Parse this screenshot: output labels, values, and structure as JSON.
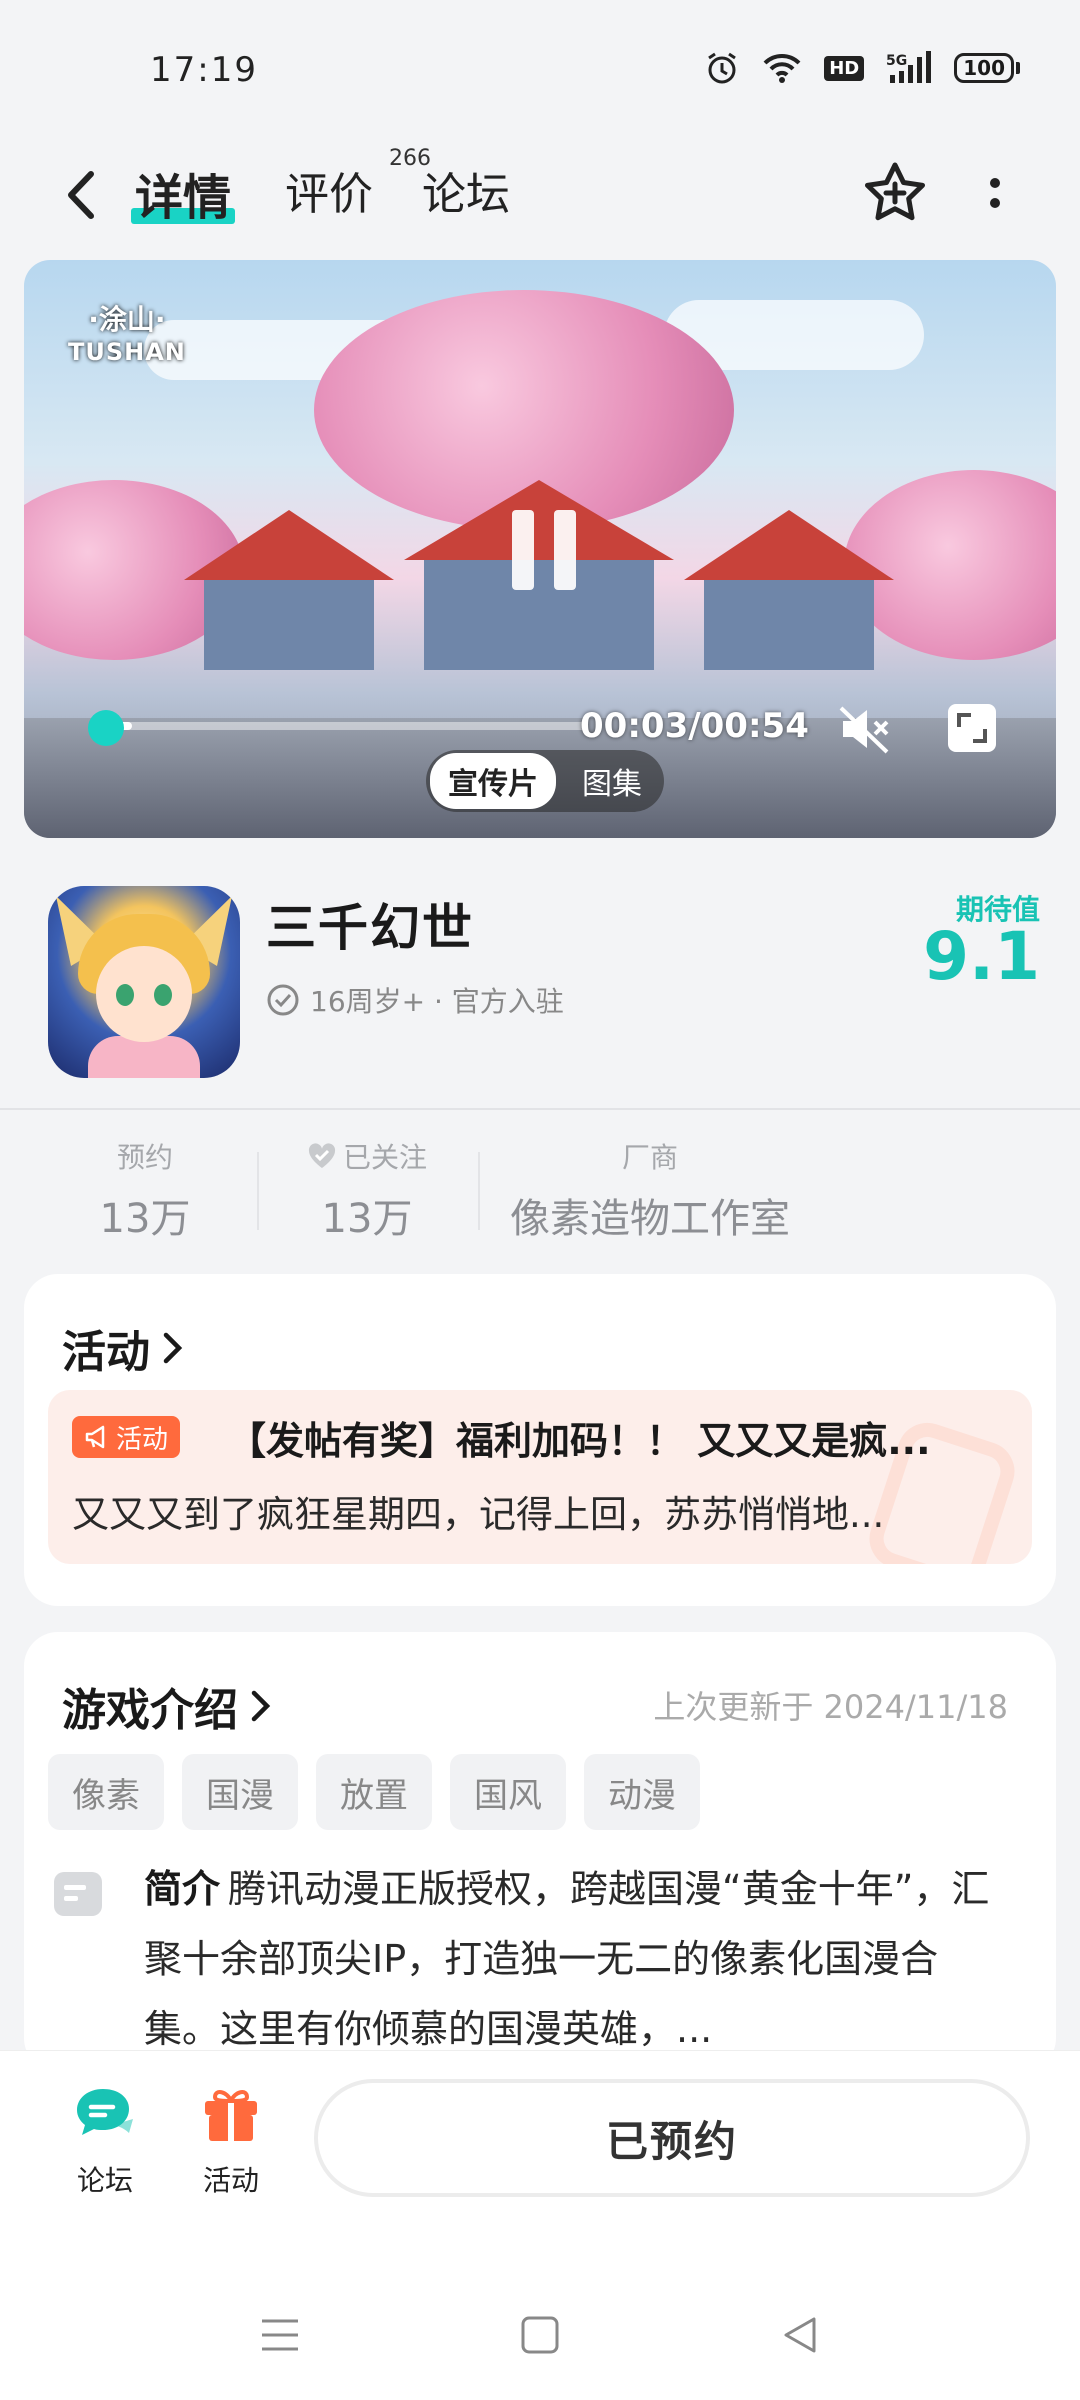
{
  "status_bar": {
    "time": "17:19",
    "network": "5G",
    "hd": "HD",
    "battery": "100"
  },
  "header": {
    "tabs": [
      {
        "label": "详情",
        "active": true
      },
      {
        "label": "评价",
        "badge": "266"
      },
      {
        "label": "论坛"
      }
    ]
  },
  "video": {
    "logo_line1": "·涂山·",
    "logo_line2": "TUSHAN",
    "time": "00:03/00:54",
    "progress": 0.055,
    "segments": [
      "宣传片",
      "图集"
    ],
    "active_segment": "宣传片"
  },
  "game": {
    "title": "三千幻世",
    "meta": "16周岁+ · 官方入驻",
    "expect_label": "期待值",
    "expect_value": "9.1"
  },
  "stats": [
    {
      "label": "预约",
      "value": "13万"
    },
    {
      "label": "已关注",
      "value": "13万"
    },
    {
      "label": "厂商",
      "value": "像素造物工作室"
    }
  ],
  "activity": {
    "title": "活动",
    "tag": "活动",
    "post_title": "【发帖有奖】福利加码！！ 又又又是疯...",
    "post_desc": "又又又到了疯狂星期四，记得上回，苏苏悄悄地..."
  },
  "intro": {
    "title": "游戏介绍",
    "updated": "上次更新于 2024/11/18",
    "tags": [
      "像素",
      "国漫",
      "放置",
      "国风",
      "动漫"
    ],
    "label": "简介",
    "text": "腾讯动漫正版授权，跨越国漫“黄金十年”，汇聚十余部顶尖IP，打造独一无二的像素化国漫合集。这里有你倾慕的国漫英雄，..."
  },
  "bottom_bar": {
    "forum_label": "论坛",
    "activity_label": "活动",
    "reserve_label": "已预约"
  },
  "colors": {
    "accent": "#19d3c5",
    "orange": "#ff6a3d"
  }
}
